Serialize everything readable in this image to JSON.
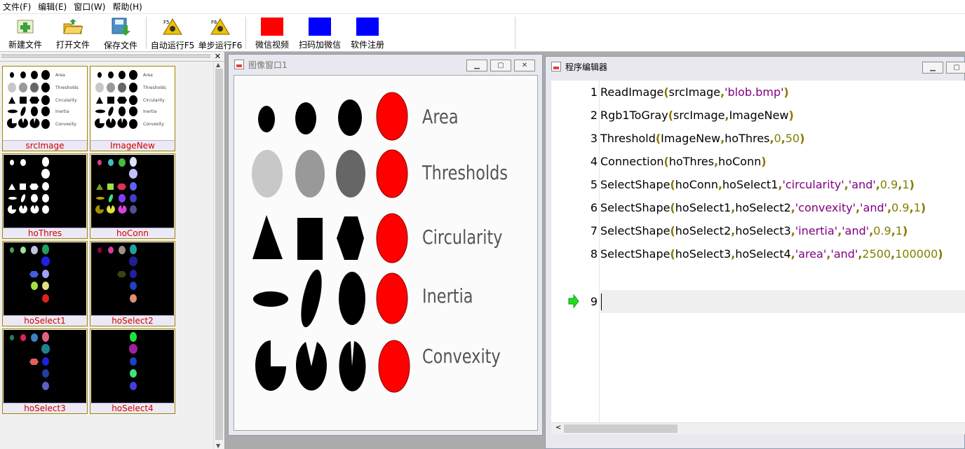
{
  "menu": [
    "文件(F)",
    "编辑(E)",
    "窗口(W)",
    "帮助(H)"
  ],
  "toolbar": {
    "new_file": "新建文件",
    "open_file": "打开文件",
    "save_file": "保存文件",
    "auto_run": "自动运行F5",
    "step_run": "单步运行F6",
    "wechat_video": "微信视频",
    "scan_wechat": "扫码加微信",
    "register": "软件注册",
    "colors": {
      "wechat_video": "#ff0000",
      "scan_wechat": "#0000ff",
      "register": "#0000ff"
    }
  },
  "thumbnails": [
    "srcImage",
    "ImageNew",
    "hoThres",
    "hoConn",
    "hoSelect1",
    "hoSelect2",
    "hoSelect3",
    "hoSelect4"
  ],
  "image_window": {
    "title": "图像窗口1",
    "row_labels": [
      "Area",
      "Thresholds",
      "Circularity",
      "Inertia",
      "Convexity"
    ]
  },
  "editor": {
    "title": "程序编辑器",
    "current_line": "9",
    "lines": [
      {
        "n": "1",
        "parts": [
          [
            "f",
            "ReadImage"
          ],
          [
            "p",
            "("
          ],
          [
            "t",
            "srcImage"
          ],
          [
            "c",
            ","
          ],
          [
            "s",
            "'blob.bmp'"
          ],
          [
            "p",
            ")"
          ]
        ]
      },
      {
        "n": "2",
        "parts": [
          [
            "f",
            "Rgb1ToGray"
          ],
          [
            "p",
            "("
          ],
          [
            "t",
            "srcImage"
          ],
          [
            "c",
            ","
          ],
          [
            "t",
            "ImageNew"
          ],
          [
            "p",
            ")"
          ]
        ]
      },
      {
        "n": "3",
        "parts": [
          [
            "f",
            "Threshold"
          ],
          [
            "p",
            "("
          ],
          [
            "t",
            "ImageNew"
          ],
          [
            "c",
            ","
          ],
          [
            "t",
            "hoThres"
          ],
          [
            "c",
            ","
          ],
          [
            "n",
            "0"
          ],
          [
            "c",
            ","
          ],
          [
            "n",
            "50"
          ],
          [
            "p",
            ")"
          ]
        ]
      },
      {
        "n": "4",
        "parts": [
          [
            "f",
            "Connection"
          ],
          [
            "p",
            "("
          ],
          [
            "t",
            "hoThres"
          ],
          [
            "c",
            ","
          ],
          [
            "t",
            "hoConn"
          ],
          [
            "p",
            ")"
          ]
        ]
      },
      {
        "n": "5",
        "parts": [
          [
            "f",
            "SelectShape"
          ],
          [
            "p",
            "("
          ],
          [
            "t",
            "hoConn"
          ],
          [
            "c",
            ","
          ],
          [
            "t",
            "hoSelect1"
          ],
          [
            "c",
            ","
          ],
          [
            "s",
            "'circularity'"
          ],
          [
            "c",
            ","
          ],
          [
            "s",
            "'and'"
          ],
          [
            "c",
            ","
          ],
          [
            "n",
            "0.9"
          ],
          [
            "c",
            ","
          ],
          [
            "n",
            "1"
          ],
          [
            "p",
            ")"
          ]
        ]
      },
      {
        "n": "6",
        "parts": [
          [
            "f",
            "SelectShape"
          ],
          [
            "p",
            "("
          ],
          [
            "t",
            "hoSelect1"
          ],
          [
            "c",
            ","
          ],
          [
            "t",
            "hoSelect2"
          ],
          [
            "c",
            ","
          ],
          [
            "s",
            "'convexity'"
          ],
          [
            "c",
            ","
          ],
          [
            "s",
            "'and'"
          ],
          [
            "c",
            ","
          ],
          [
            "n",
            "0.9"
          ],
          [
            "c",
            ","
          ],
          [
            "n",
            "1"
          ],
          [
            "p",
            ")"
          ]
        ]
      },
      {
        "n": "7",
        "parts": [
          [
            "f",
            "SelectShape"
          ],
          [
            "p",
            "("
          ],
          [
            "t",
            "hoSelect2"
          ],
          [
            "c",
            ","
          ],
          [
            "t",
            "hoSelect3"
          ],
          [
            "c",
            ","
          ],
          [
            "s",
            "'inertia'"
          ],
          [
            "c",
            ","
          ],
          [
            "s",
            "'and'"
          ],
          [
            "c",
            ","
          ],
          [
            "n",
            "0.9"
          ],
          [
            "c",
            ","
          ],
          [
            "n",
            "1"
          ],
          [
            "p",
            ")"
          ]
        ]
      },
      {
        "n": "8",
        "parts": [
          [
            "f",
            "SelectShape"
          ],
          [
            "p",
            "("
          ],
          [
            "t",
            "hoSelect3"
          ],
          [
            "c",
            ","
          ],
          [
            "t",
            "hoSelect4"
          ],
          [
            "c",
            ","
          ],
          [
            "s",
            "'area'"
          ],
          [
            "c",
            ","
          ],
          [
            "s",
            "'and'"
          ],
          [
            "c",
            ","
          ],
          [
            "n",
            "2500"
          ],
          [
            "c",
            ","
          ],
          [
            "n",
            "100000"
          ],
          [
            "p",
            ")"
          ]
        ]
      }
    ]
  }
}
